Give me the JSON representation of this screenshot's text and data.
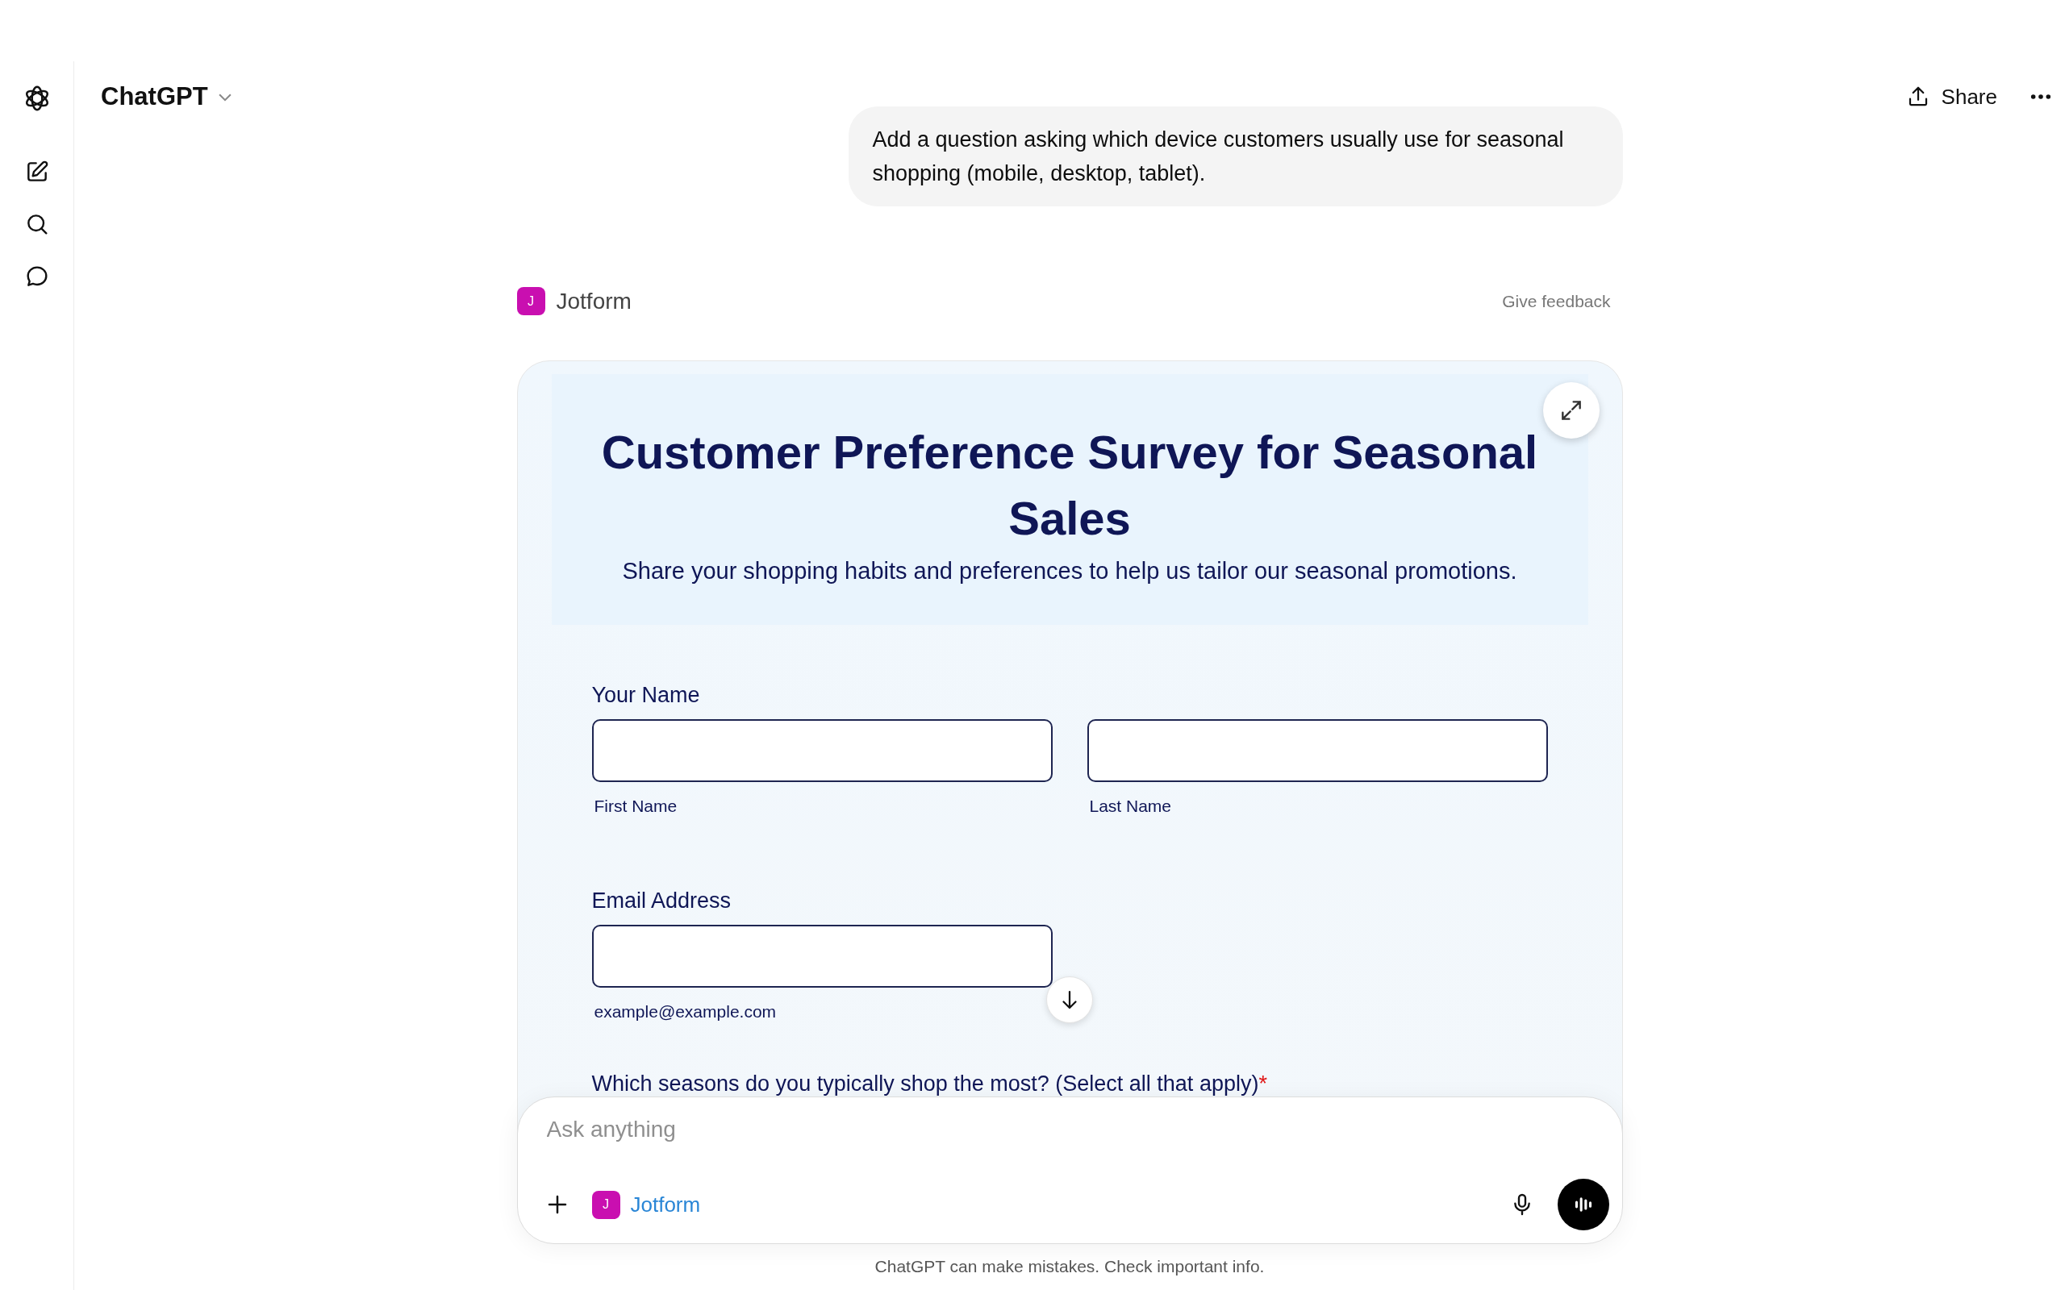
{
  "header": {
    "title": "ChatGPT",
    "share": "Share"
  },
  "user_message": "Add a question asking which device customers usually use for seasonal shopping (mobile, desktop, tablet).",
  "app_block": {
    "initial": "J",
    "name": "Jotform",
    "feedback": "Give feedback"
  },
  "form": {
    "title": "Customer Preference Survey for Seasonal Sales",
    "description": "Share your shopping habits and preferences to help us tailor our seasonal promotions.",
    "required_mark": "*",
    "fields": [
      {
        "kind": "name",
        "label": "Your Name",
        "required": false,
        "sublabels": [
          "First Name",
          "Last Name"
        ]
      },
      {
        "kind": "email",
        "label": "Email Address",
        "required": false,
        "hint": "example@example.com"
      },
      {
        "kind": "question",
        "label": "Which seasons do you typically shop the most? (Select all that apply)",
        "required": true
      }
    ]
  },
  "composer": {
    "placeholder": "Ask anything",
    "chip": {
      "initial": "J",
      "name": "Jotform"
    }
  },
  "footer": "ChatGPT can make mistakes. Check important info."
}
